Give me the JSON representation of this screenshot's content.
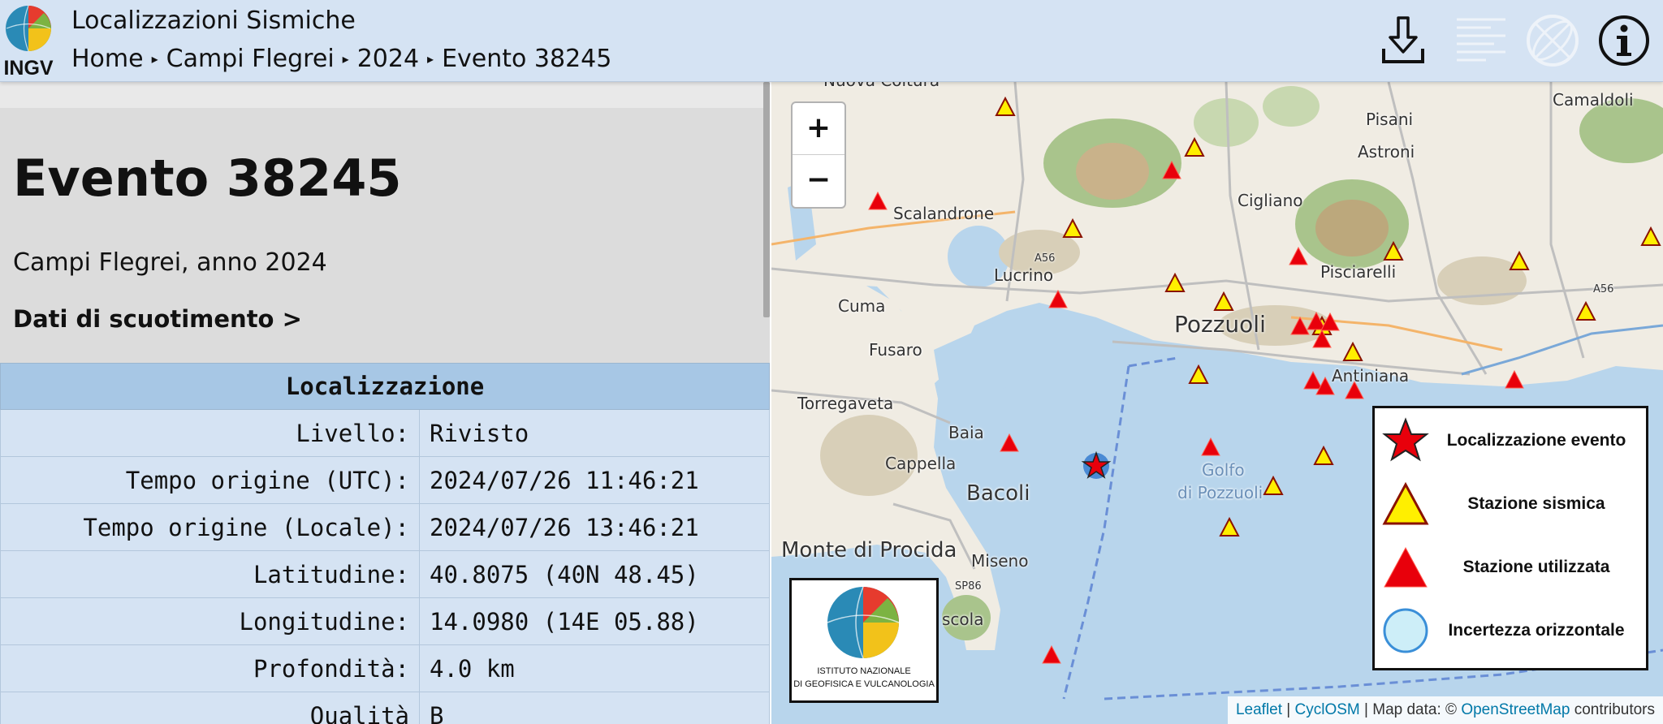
{
  "header": {
    "logo_text": "INGV",
    "app_title": "Localizzazioni Sismiche",
    "breadcrumb": [
      "Home",
      "Campi Flegrei",
      "2024",
      "Evento 38245"
    ],
    "icons": [
      "download-icon",
      "list-icon",
      "globe-icon",
      "info-icon"
    ]
  },
  "event": {
    "title": "Evento 38245",
    "subtitle": "Campi Flegrei, anno 2024",
    "shaking_link": "Dati di scuotimento >"
  },
  "table": {
    "header": "Localizzazione",
    "rows": [
      {
        "label": "Livello:",
        "value": "Rivisto"
      },
      {
        "label": "Tempo origine (UTC):",
        "value": "2024/07/26 11:46:21"
      },
      {
        "label": "Tempo origine (Locale):",
        "value": "2024/07/26 13:46:21"
      },
      {
        "label": "Latitudine:",
        "value": "40.8075 (40N 48.45)"
      },
      {
        "label": "Longitudine:",
        "value": "14.0980 (14E 05.88)"
      },
      {
        "label": "Profondità:",
        "value": "4.0 km"
      },
      {
        "label": "Qualità",
        "value": "B"
      }
    ]
  },
  "map": {
    "zoom_in": "+",
    "zoom_out": "−",
    "places": {
      "nuova_coltura": "Nuova Coltura",
      "scalandrone": "Scalandrone",
      "cigliano": "Cigliano",
      "pisani": "Pisani",
      "astroni": "Astroni",
      "camaldoli": "Camaldoli",
      "lucrino": "Lucrino",
      "pisciarelli": "Pisciarelli",
      "cuma": "Cuma",
      "pozzuoli": "Pozzuoli",
      "fusaro": "Fusaro",
      "antiniana": "Antiniana",
      "torregaveta": "Torregaveta",
      "baia": "Baia",
      "cappella": "Cappella",
      "bacoli": "Bacoli",
      "golfo_1": "Golfo",
      "golfo_2": "di Pozzuoli",
      "monte_di_procida": "Monte di Procida",
      "miseno": "Miseno",
      "scola": "scola",
      "a56": "A56",
      "a56b": "A56",
      "sp86": "SP86"
    },
    "legend": [
      {
        "icon": "star-icon",
        "label": "Localizzazione evento"
      },
      {
        "icon": "triangle-yellow-icon",
        "label": "Stazione sismica"
      },
      {
        "icon": "triangle-red-icon",
        "label": "Stazione utilizzata"
      },
      {
        "icon": "circle-icon",
        "label": "Incertezza orizzontale"
      }
    ],
    "badge": {
      "line1": "ISTITUTO NAZIONALE",
      "line2": "DI GEOFISICA E VULCANOLOGIA"
    },
    "attribution": {
      "leaflet": "Leaflet",
      "sep1": " | ",
      "cyclosm": "CyclOSM",
      "mapdata": " | Map data: © ",
      "osm": "OpenStreetMap",
      "contributors": " contributors"
    },
    "colors": {
      "sea": "#b8d5ec",
      "land": "#f2efe9",
      "station_used": "#e8000b",
      "station": "#ffef00"
    }
  }
}
